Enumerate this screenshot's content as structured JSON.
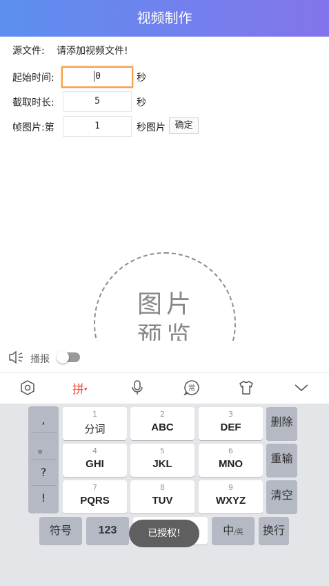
{
  "header": {
    "title": "视频制作"
  },
  "source": {
    "label": "源文件:",
    "value": "请添加视频文件!"
  },
  "start_time": {
    "label": "起始时间:",
    "value": "0",
    "unit": "秒"
  },
  "duration": {
    "label": "截取时长:",
    "value": "5",
    "unit": "秒"
  },
  "frame": {
    "label": "帧图片:第",
    "value": "1",
    "unit": "秒图片",
    "confirm_label": "确定"
  },
  "preview": {
    "line1": "图片",
    "line2": "预览"
  },
  "broadcast": {
    "label": "播报",
    "enabled": false
  },
  "ime_toolbar": {
    "pinyin_label": "拼",
    "icons": [
      "settings-icon",
      "microphone-icon",
      "frequent-phrases-icon",
      "skin-shirt-icon",
      "collapse-chevron-icon"
    ]
  },
  "keyboard": {
    "punctuation": [
      ",",
      "。",
      "?",
      "!"
    ],
    "keys": [
      {
        "num": "1",
        "label": "分词"
      },
      {
        "num": "2",
        "label": "ABC"
      },
      {
        "num": "3",
        "label": "DEF"
      },
      {
        "num": "4",
        "label": "GHI"
      },
      {
        "num": "5",
        "label": "JKL"
      },
      {
        "num": "6",
        "label": "MNO"
      },
      {
        "num": "7",
        "label": "PQRS"
      },
      {
        "num": "8",
        "label": "TUV"
      },
      {
        "num": "9",
        "label": "WXYZ"
      }
    ],
    "delete_label": "删除",
    "reenter_label": "重输",
    "clear_label": "清空",
    "symbols_label": "符号",
    "numbers_label": "123",
    "lang_label": "中",
    "lang_sub_label": "/英",
    "enter_label": "换行"
  },
  "toast": {
    "text": "已授权!"
  }
}
